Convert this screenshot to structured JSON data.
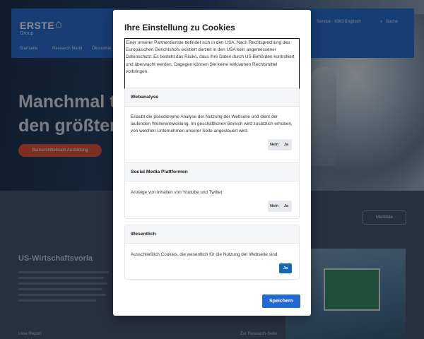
{
  "background": {
    "logo": {
      "name": "ERSTE",
      "sub": "Group"
    },
    "nav": [
      "Startseite",
      "Research Markt",
      "Ökonomie"
    ],
    "top_links": [
      "Service · 6363",
      "Englisch",
      "Suche"
    ],
    "hero": {
      "title_line1": "Manchmal t",
      "title_line2": "den größten",
      "button": "Bankenmittelteam Ausbildung"
    },
    "watch_button": "Merkliste",
    "section_title": "US-Wirtschaftsvorla",
    "bottom_labels": [
      "Lese Report",
      "Zur Research-Seite"
    ]
  },
  "modal": {
    "title": "Ihre Einstellung zu Cookies",
    "notice": "Einer unserer Partnerdienste befindet sich in den USA. Nach Rechtsprechung des Europäischen Gerichtshofs existiert derzeit in den USA kein angemessener Datenschutz. Es besteht das Risiko, dass Ihre Daten durch US-Behörden kontrolliert und überwacht werden. Dagegen können Sie keine wirksamen Rechtsmittel vorbringen.",
    "categories": [
      {
        "title": "Webanalyse",
        "text": "Erlaubt die pseudonyme Analyse der Nutzung der Webseite und dient der laufenden Weiterentwicklung. Im geschäftlichen Bereich wird zusätzlich erhoben, von welchen Unternehmen unserer Seite angesteuert wird.",
        "no_label": "Nein",
        "yes_label": "Ja"
      },
      {
        "title": "Social Media Plattformen",
        "text": "Anzeige von Inhalten von Youtube und Twitter.",
        "no_label": "Nein",
        "yes_label": "Ja"
      },
      {
        "title": "Wesentlich",
        "text": "Ausschließlich Cookies, die wesentlich für die Nutzung der Webseite sind.",
        "yes_label": "Ja"
      }
    ],
    "save_label": "Speichern"
  },
  "colors": {
    "primary": "#2468d6",
    "essential_yes": "#1768ba",
    "toggle_bg": "#e5e8ec",
    "card_header": "#f4f5f7"
  }
}
